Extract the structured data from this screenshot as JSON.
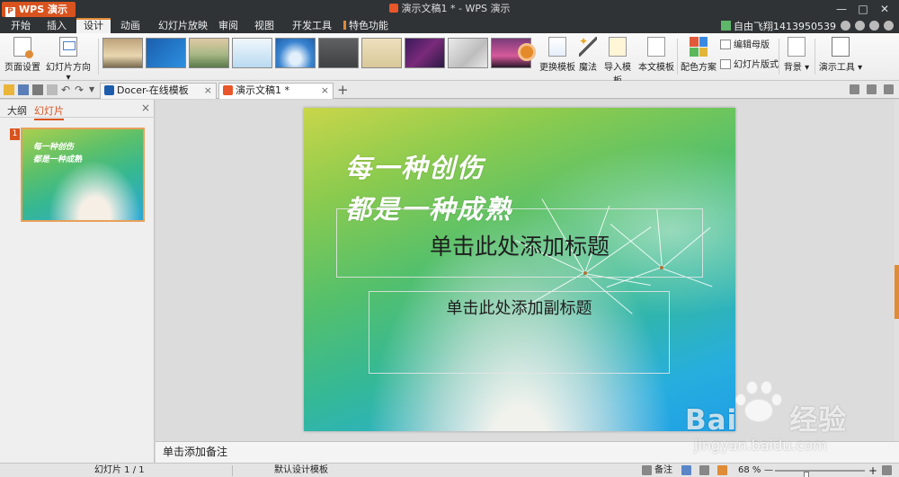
{
  "app": {
    "name": "WPS 演示",
    "logo_letter": "P"
  },
  "title": {
    "doc": "演示文稿1 * - WPS 演示"
  },
  "window": {
    "minimize": "—",
    "maximize": "□",
    "close": "✕"
  },
  "menu": {
    "tabs": [
      "开始",
      "插入",
      "设计",
      "动画",
      "幻灯片放映",
      "审阅",
      "视图",
      "开发工具",
      "特色功能"
    ],
    "active": "设计",
    "user": "自由飞翔1413950539"
  },
  "ribbon": {
    "page_setup": "页面设置",
    "orientation": "幻灯片方向",
    "change_template": "更换模板",
    "magic": "魔法",
    "import_template": "导入模板",
    "this_template": "本文模板",
    "color_scheme": "配色方案",
    "edit_master": "编辑母版",
    "slide_layout": "幻灯片版式",
    "background": "背景",
    "presentation_tools": "演示工具"
  },
  "tabs_bar": {
    "docer": "Docer-在线模板",
    "doc1": "演示文稿1 *",
    "close": "×",
    "add": "+"
  },
  "left_panel": {
    "tab_outline": "大纲",
    "tab_slides": "幻灯片",
    "close": "×",
    "slide_number": "1",
    "thumb_line1": "每一种创伤",
    "thumb_line2": "都是一种成熟"
  },
  "slide": {
    "line1": "每一种创伤",
    "line2": "都是一种成熟",
    "title_placeholder": "单击此处添加标题",
    "subtitle_placeholder": "单击此处添加副标题"
  },
  "notes": {
    "placeholder": "单击添加备注"
  },
  "status": {
    "slide_count": "幻灯片 1 / 1",
    "template": "默认设计模板",
    "notes": "备注",
    "zoom": "68 %",
    "zoom_out": "—",
    "zoom_in": "+",
    "zoom_level": 68
  },
  "watermark": {
    "brand": "Bai",
    "brand2": "经验",
    "url": "jingyan.baidu.com"
  }
}
